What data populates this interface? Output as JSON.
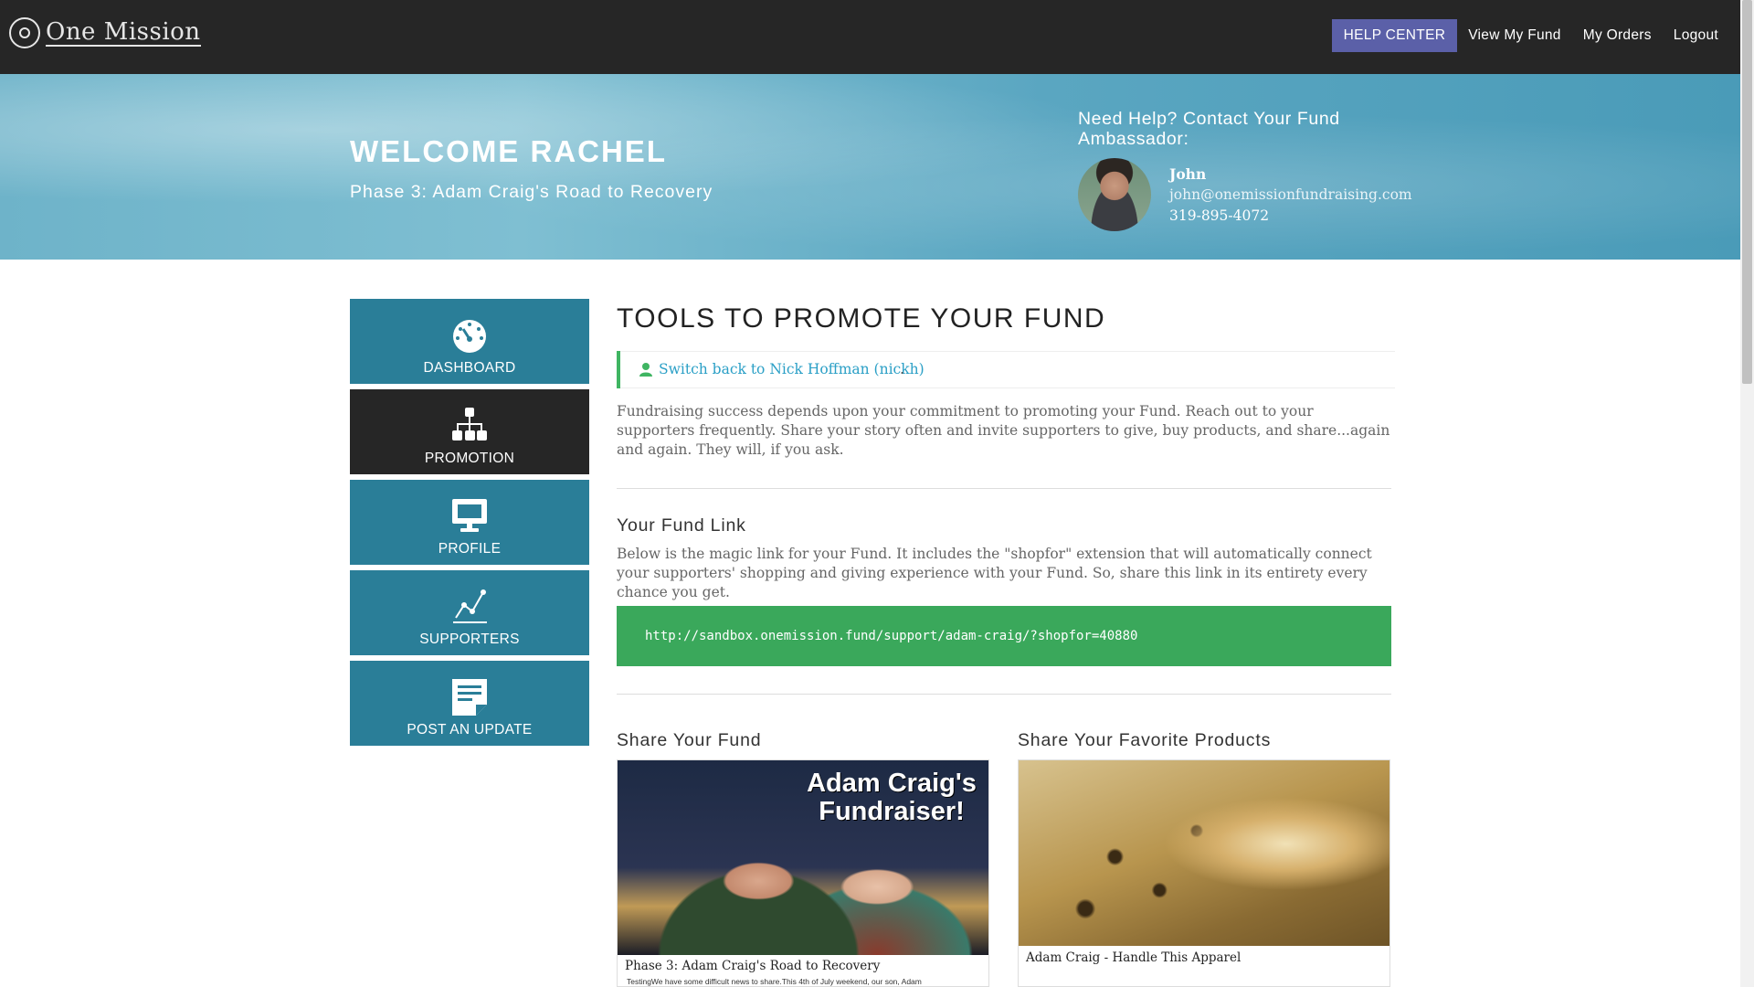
{
  "header": {
    "logo_text": "One Mission",
    "nav": {
      "help_center": "HELP CENTER",
      "view_my_fund": "View My Fund",
      "my_orders": "My Orders",
      "logout": "Logout"
    }
  },
  "hero": {
    "welcome": "WELCOME RACHEL",
    "phase": "Phase 3: Adam Craig's Road to Recovery",
    "help_title": "Need Help? Contact Your Fund Ambassador:",
    "ambassador": {
      "name": "John",
      "email": "john@onemissionfundraising.com",
      "phone": "319-895-4072"
    }
  },
  "sidebar": {
    "items": [
      {
        "label": "DASHBOARD",
        "icon": "dashboard-gauge-icon"
      },
      {
        "label": "PROMOTION",
        "icon": "sitemap-icon"
      },
      {
        "label": "PROFILE",
        "icon": "monitor-icon"
      },
      {
        "label": "SUPPORTERS",
        "icon": "line-chart-icon"
      },
      {
        "label": "POST AN UPDATE",
        "icon": "note-icon"
      }
    ]
  },
  "main": {
    "title": "TOOLS TO PROMOTE YOUR FUND",
    "switch_back": "Switch back to Nick Hoffman (nickh)",
    "switch_back_suffix": ".",
    "intro": "Fundraising success depends upon your commitment to promoting your Fund. Reach out to your supporters frequently. Share your story often and invite supporters to give, buy products, and share...again and again. They will, if you ask.",
    "fund_link_title": "Your Fund Link",
    "fund_link_desc": "Below is the magic link for your Fund. It includes the \"shopfor\" extension that will automatically connect your supporters' shopping and giving experience with your Fund. So, share this link in its entirety every chance you get.",
    "fund_link_url": "http://sandbox.onemission.fund/support/adam-craig/?shopfor=40880",
    "share_fund_title": "Share Your Fund",
    "share_products_title": "Share Your Favorite Products",
    "fund_card": {
      "image_title": "Adam Craig's Fundraiser!",
      "caption": "Phase 3: Adam Craig's Road to Recovery",
      "excerpt": "TestingWe have some difficult news to share.This 4th of July weekend, our son, Adam"
    },
    "product_card": {
      "caption": "Adam Craig - Handle This Apparel"
    }
  },
  "colors": {
    "navbar": "#262626",
    "help_button": "#5b60a8",
    "tile": "#2a7e98",
    "tile_active": "#262626",
    "link_box": "#3aa85b",
    "accent_green": "#3fb562"
  }
}
